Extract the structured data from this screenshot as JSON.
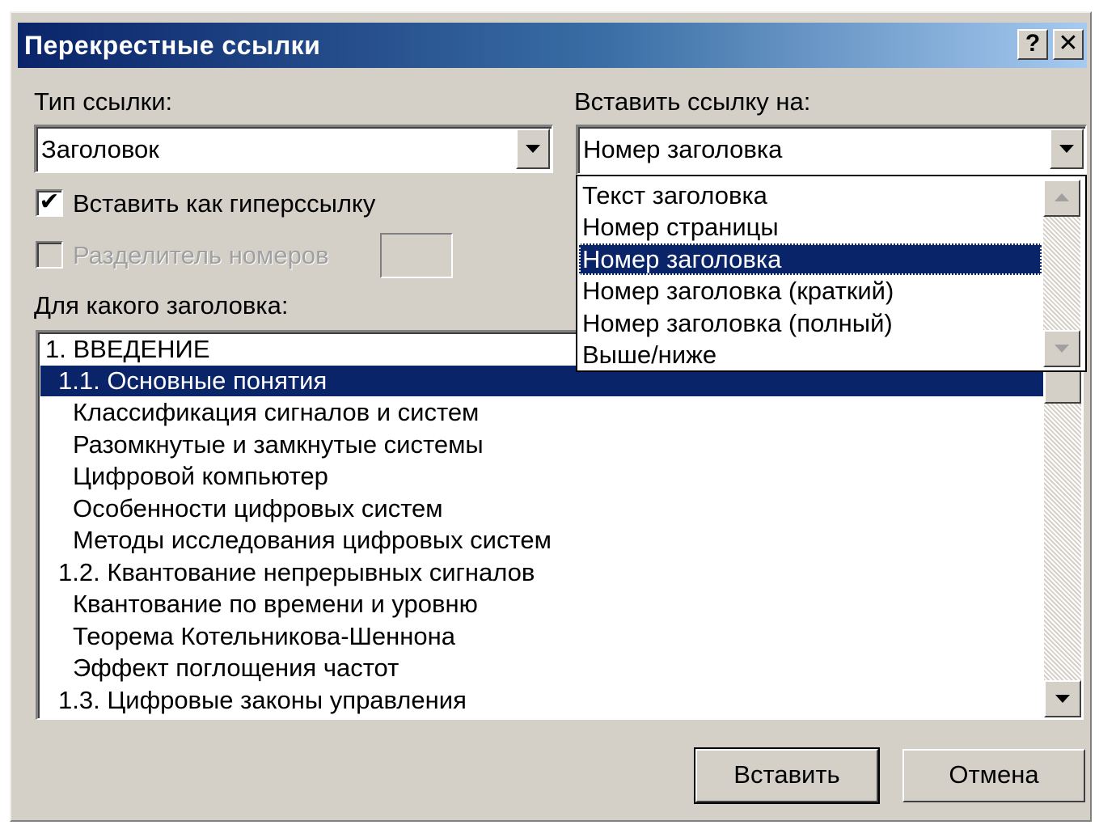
{
  "dialog": {
    "title": "Перекрестные ссылки",
    "help_button": "?",
    "close_button": "✕"
  },
  "ref_type": {
    "label": "Тип ссылки:",
    "value": "Заголовок"
  },
  "insert_ref": {
    "label": "Вставить ссылку на:",
    "value": "Номер заголовка",
    "options": [
      "Текст заголовка",
      "Номер страницы",
      "Номер заголовка",
      "Номер заголовка (краткий)",
      "Номер заголовка (полный)",
      "Выше/ниже"
    ],
    "selected_index": 2
  },
  "hyperlink_checkbox": {
    "label": "Вставить как гиперссылку",
    "checked": true
  },
  "separator_checkbox": {
    "label": "Разделитель номеров",
    "checked": false,
    "enabled": false
  },
  "heading_list": {
    "label": "Для какого заголовка:",
    "items": [
      "1.  ВВЕДЕНИЕ",
      "1.1. Основные понятия",
      "Классификация сигналов и систем",
      "Разомкнутые и замкнутые системы",
      "Цифровой компьютер",
      "Особенности цифровых систем",
      "Методы исследования цифровых систем",
      "1.2. Квантование непрерывных сигналов",
      "Квантование по времени и уровню",
      "Теорема Котельникова-Шеннона",
      "Эффект поглощения частот",
      "1.3. Цифровые законы управления"
    ],
    "selected_index": 1
  },
  "buttons": {
    "insert": "Вставить",
    "cancel": "Отмена"
  },
  "colors": {
    "dialog_bg": "#d4d0c8",
    "title_gradient_start": "#0a246a",
    "title_gradient_end": "#a6caf0",
    "selection": "#0a246a"
  }
}
